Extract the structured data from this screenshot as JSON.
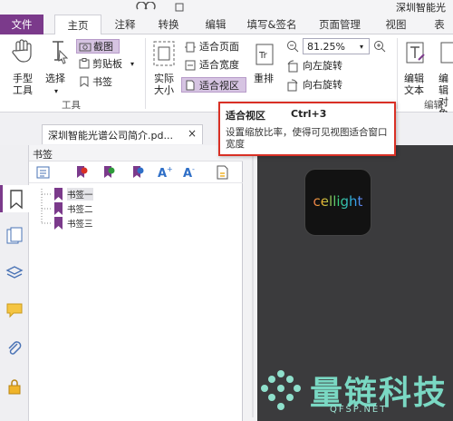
{
  "window": {
    "title": "深圳智能光"
  },
  "tabs": [
    {
      "label": "文件",
      "active": false
    },
    {
      "label": "主页",
      "active": true
    },
    {
      "label": "注释",
      "active": false
    },
    {
      "label": "转换",
      "active": false
    },
    {
      "label": "编辑",
      "active": false
    },
    {
      "label": "填写&签名",
      "active": false
    },
    {
      "label": "页面管理",
      "active": false
    },
    {
      "label": "视图",
      "active": false
    },
    {
      "label": "表",
      "active": false
    }
  ],
  "ribbon": {
    "hand_tool": "手型\n工具",
    "select": "选择",
    "screenshot": "截图",
    "clipboard": "剪贴板",
    "bookmark": "书签",
    "tools_group": "工具",
    "actual_size": "实际\n大小",
    "fit_page": "适合页面",
    "fit_width": "适合宽度",
    "fit_visible": "适合视区",
    "reflow": "重排",
    "zoom_value": "81.25%",
    "rotate_left": "向左旋转",
    "rotate_right": "向右旋转",
    "edit_text": "编辑\n文本",
    "edit_object": "编辑\n对象",
    "edit_group": "编辑"
  },
  "tooltip": {
    "title": "适合视区",
    "shortcut": "Ctrl+3",
    "description": "设置缩放比率，使得可见视图适合窗口宽度"
  },
  "document_tab": {
    "label": "深圳智能光谱公司简介.pd...",
    "close": "×"
  },
  "bookmarks": {
    "panel_title": "书签",
    "items": [
      "书签一",
      "书签二",
      "书签三"
    ]
  },
  "logo": {
    "text": "cellight"
  },
  "watermark": {
    "text": "量链科技",
    "sub": "QFSP.NET"
  },
  "colors": {
    "accent": "#7b3a8b",
    "highlight": "#d6c4e2",
    "tooltip_border": "#d93025",
    "doc_bg": "#3b3b3d"
  }
}
